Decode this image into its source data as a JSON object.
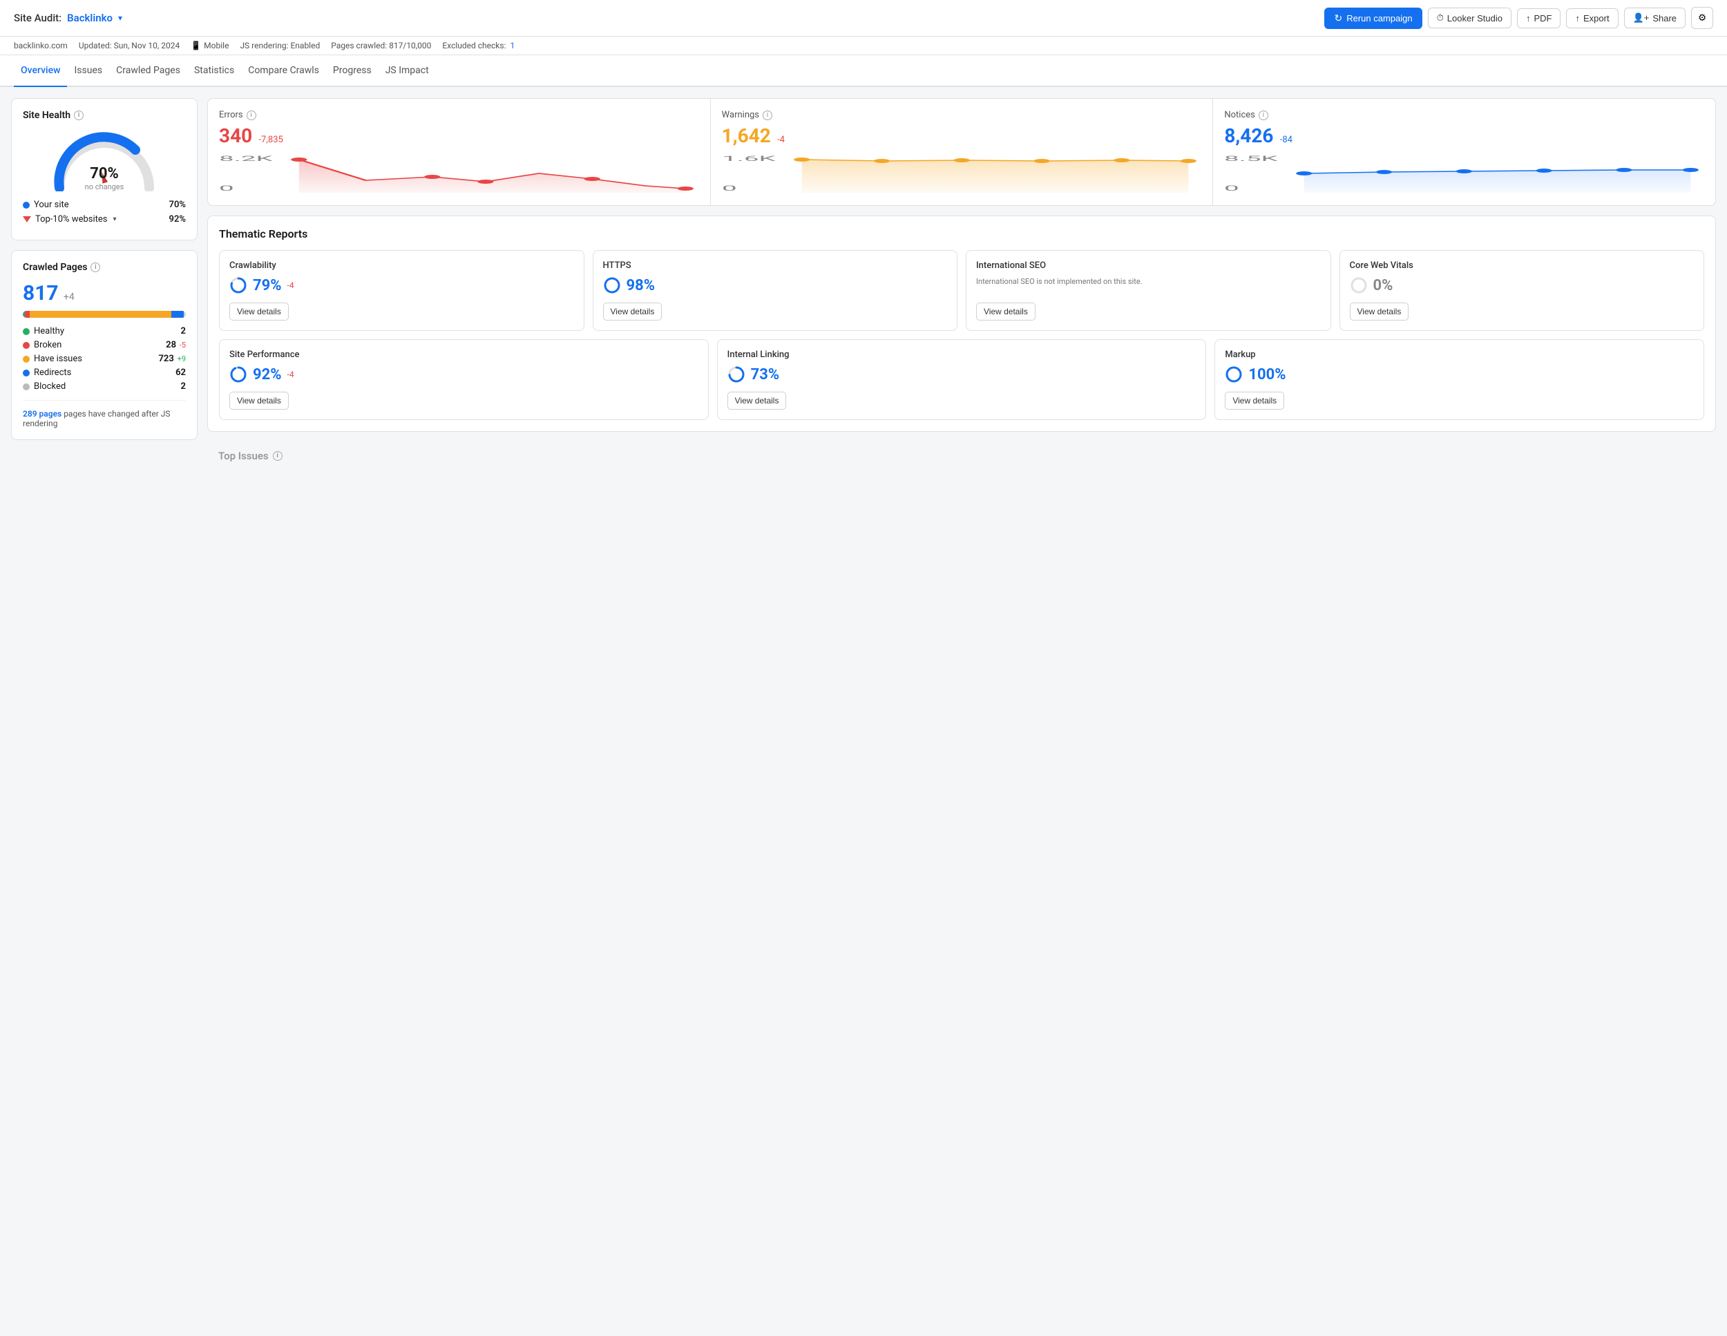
{
  "header": {
    "site_audit_label": "Site Audit:",
    "site_name": "Backlinko",
    "rerun_label": "Rerun campaign",
    "looker_studio_label": "Looker Studio",
    "pdf_label": "PDF",
    "export_label": "Export",
    "share_label": "Share"
  },
  "subheader": {
    "domain": "backlinko.com",
    "updated": "Updated: Sun, Nov 10, 2024",
    "device": "Mobile",
    "js_rendering": "JS rendering: Enabled",
    "pages_crawled": "Pages crawled: 817/10,000",
    "excluded_checks": "Excluded checks:",
    "excluded_num": "1"
  },
  "nav": {
    "items": [
      {
        "label": "Overview",
        "active": true
      },
      {
        "label": "Issues",
        "active": false
      },
      {
        "label": "Crawled Pages",
        "active": false
      },
      {
        "label": "Statistics",
        "active": false
      },
      {
        "label": "Compare Crawls",
        "active": false
      },
      {
        "label": "Progress",
        "active": false
      },
      {
        "label": "JS Impact",
        "active": false
      }
    ]
  },
  "site_health": {
    "title": "Site Health",
    "percent": "70%",
    "sub_label": "no changes",
    "your_site_label": "Your site",
    "your_site_val": "70%",
    "top10_label": "Top-10% websites",
    "top10_val": "92%"
  },
  "crawled_pages": {
    "title": "Crawled Pages",
    "total": "817",
    "delta": "+4",
    "legend": [
      {
        "label": "Healthy",
        "count": "2",
        "delta": "",
        "color": "green"
      },
      {
        "label": "Broken",
        "count": "28",
        "delta": "-5",
        "delta_type": "neg",
        "color": "red"
      },
      {
        "label": "Have issues",
        "count": "723",
        "delta": "+9",
        "delta_type": "pos",
        "color": "orange"
      },
      {
        "label": "Redirects",
        "count": "62",
        "delta": "",
        "color": "blue"
      },
      {
        "label": "Blocked",
        "count": "2",
        "delta": "",
        "color": "gray"
      }
    ],
    "changed_pages_text": " pages have changed after JS rendering",
    "changed_pages_num": "289 pages"
  },
  "errors": {
    "label": "Errors",
    "value": "340",
    "delta": "-7,835"
  },
  "warnings": {
    "label": "Warnings",
    "value": "1,642",
    "delta": "-4"
  },
  "notices": {
    "label": "Notices",
    "value": "8,426",
    "delta": "-84"
  },
  "thematic_reports": {
    "title": "Thematic Reports",
    "items_top": [
      {
        "name": "Crawlability",
        "percent": "79%",
        "delta": "-4",
        "has_ring": true,
        "ring_color": "#1570ef",
        "view_details": "View details"
      },
      {
        "name": "HTTPS",
        "percent": "98%",
        "delta": "",
        "has_ring": true,
        "ring_color": "#1570ef",
        "view_details": "View details"
      },
      {
        "name": "International SEO",
        "percent": "",
        "desc": "International SEO is not implemented on this site.",
        "has_ring": false,
        "view_details": "View details"
      },
      {
        "name": "Core Web Vitals",
        "percent": "0%",
        "delta": "",
        "has_ring": true,
        "ring_color": "#bbb",
        "view_details": "View details"
      }
    ],
    "items_bottom": [
      {
        "name": "Site Performance",
        "percent": "92%",
        "delta": "-4",
        "has_ring": true,
        "ring_color": "#1570ef",
        "view_details": "View details"
      },
      {
        "name": "Internal Linking",
        "percent": "73%",
        "delta": "",
        "has_ring": true,
        "ring_color": "#1570ef",
        "view_details": "View details"
      },
      {
        "name": "Markup",
        "percent": "100%",
        "delta": "",
        "has_ring": true,
        "ring_color": "#1570ef",
        "view_details": "View details"
      }
    ]
  },
  "top_issues": {
    "title": "Top Issues"
  }
}
